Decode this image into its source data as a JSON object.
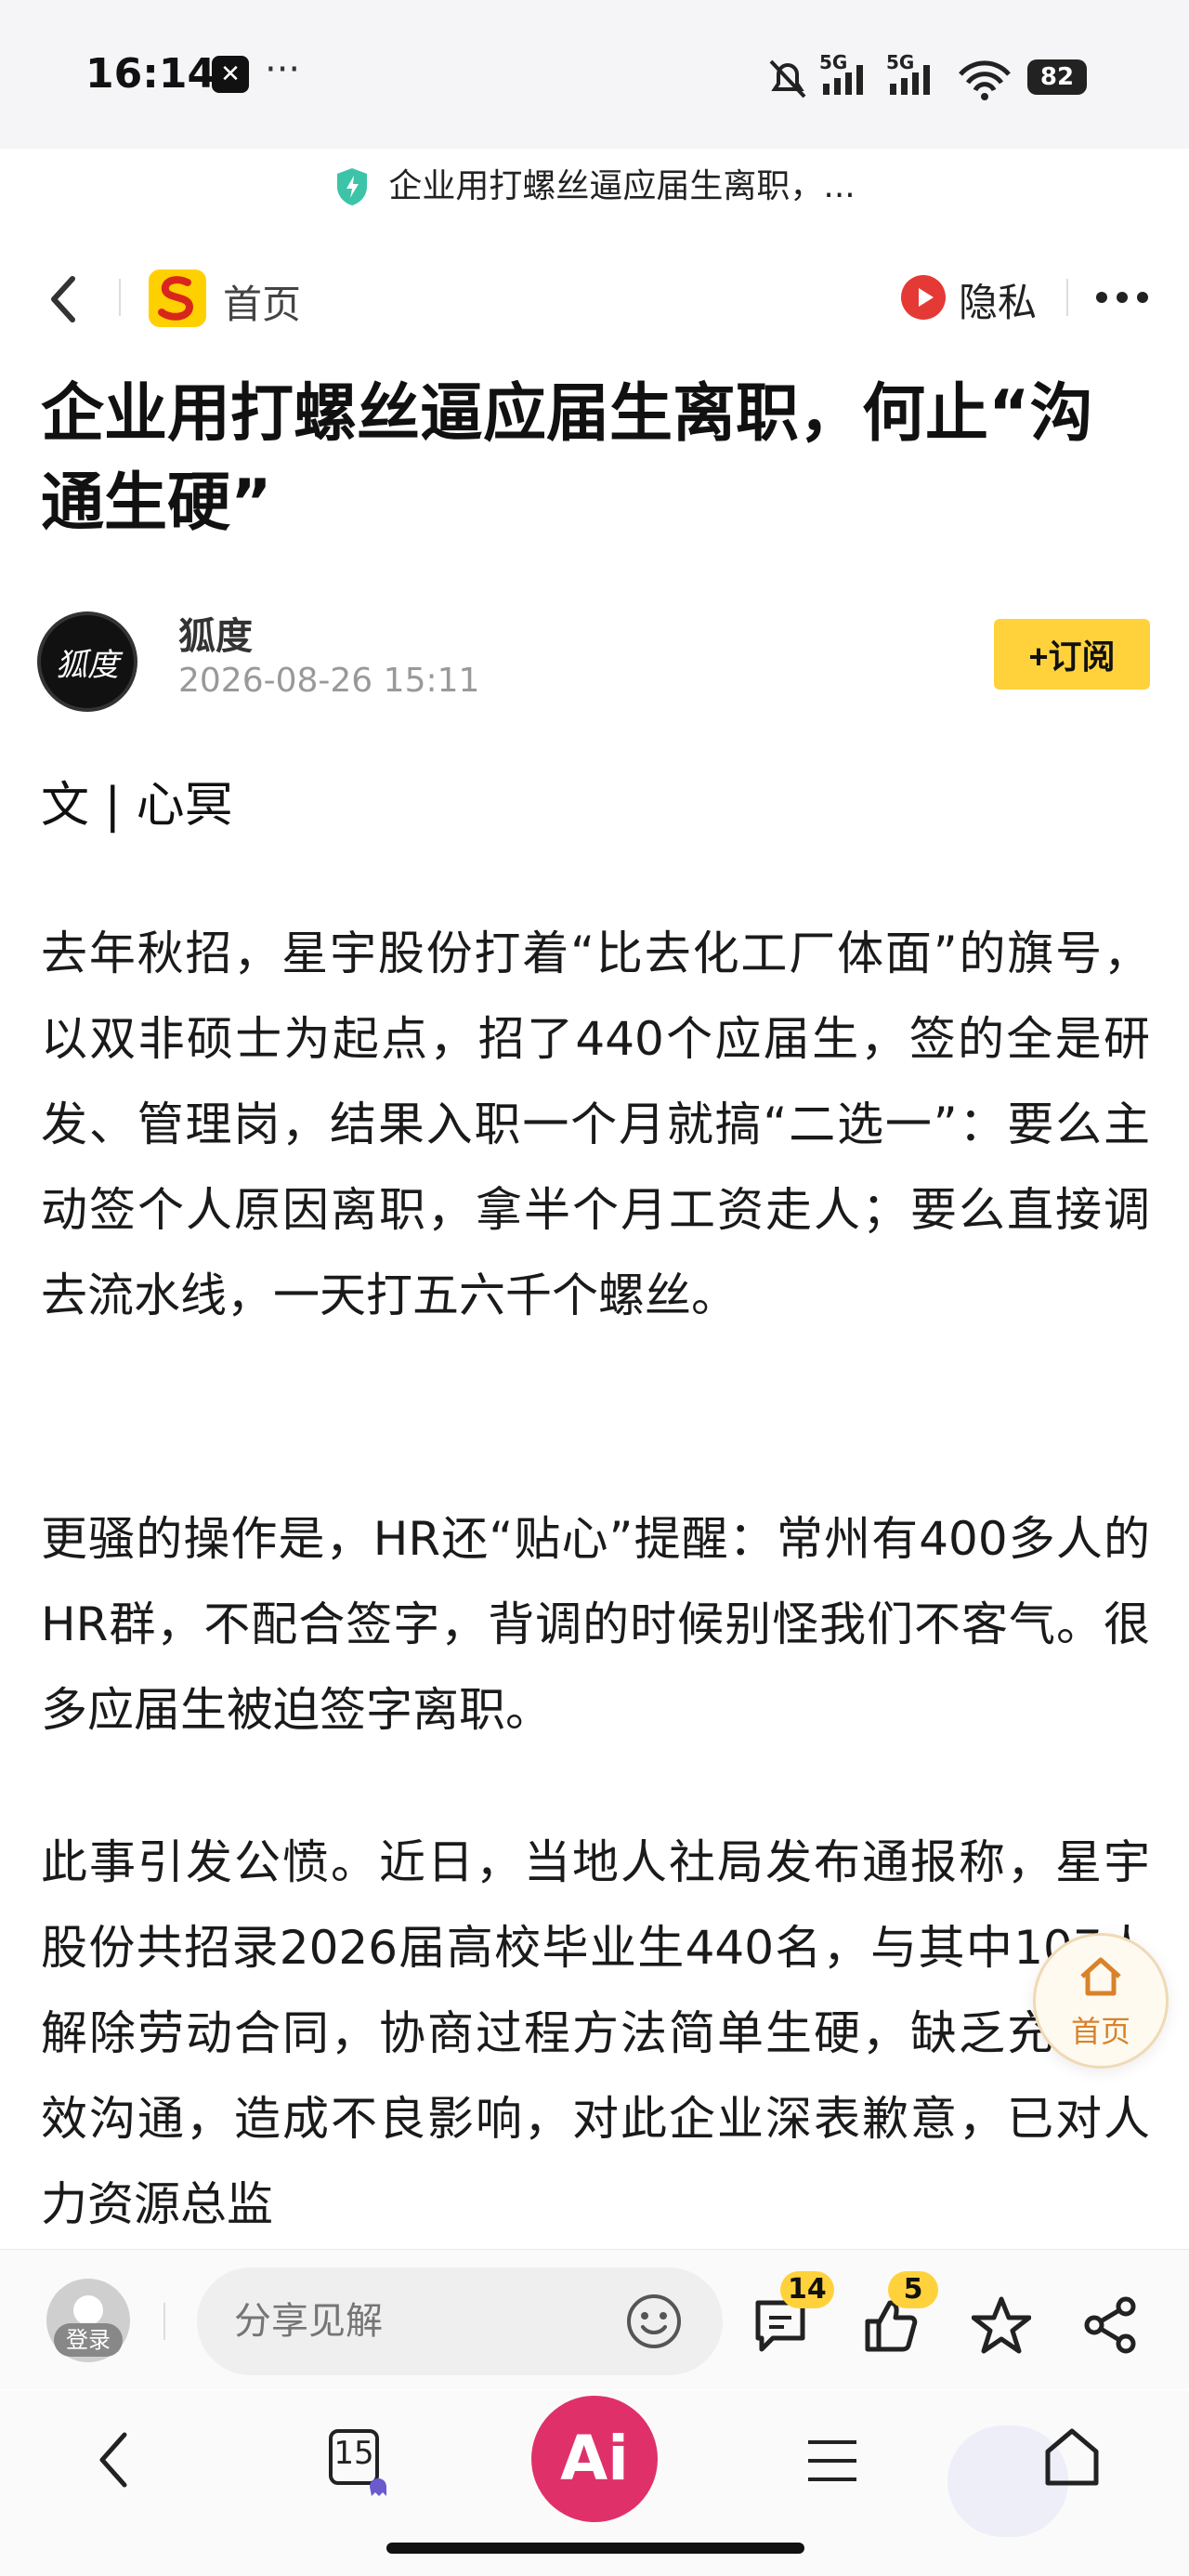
{
  "status_bar": {
    "time": "16:14",
    "dots": "···",
    "signal_label_1": "5G",
    "signal_label_2": "5G",
    "battery": "82"
  },
  "url_bar": {
    "text": "企业用打螺丝逼应届生离职，..."
  },
  "nav": {
    "home_label": "首页",
    "privacy_label": "隐私"
  },
  "article": {
    "title": "企业用打螺丝逼应届生离职，何止“沟通生硬”",
    "author": "狐度",
    "date": "2026-08-26 15:11",
    "subscribe_label": "+订阅",
    "avatar_text": "狐度",
    "byline": "文 | 心冥",
    "paragraphs": [
      "去年秋招，星宇股份打着“比去化工厂体面”的旗号，以双非硕士为起点，招了440个应届生，签的全是研发、管理岗，结果入职一个月就搞“二选一”：要么主动签个人原因离职，拿半个月工资走人；要么直接调去流水线，一天打五六千个螺丝。",
      "更骚的操作是，HR还“贴心”提醒：常州有400多人的HR群，不配合签字，背调的时候别怪我们不客气。很多应届生被迫签字离职。",
      "此事引发公愤。近日，当地人社局发布通报称，星宇股份共招录2026届高校毕业生440名，与其中107人解除劳动合同，协商过程方法简单生硬，缺乏充分有效沟通，造成不良影响，对此企业深表歉意，已对人力资源总监"
    ]
  },
  "floating_home": {
    "label": "首页"
  },
  "comment_bar": {
    "login_label": "登录",
    "input_placeholder": "分享见解",
    "comment_count": "14",
    "like_count": "5"
  },
  "browser_bar": {
    "tabs_count": "15",
    "ai_label": "Ai"
  },
  "colors": {
    "accent_yellow": "#ffd23c",
    "ai_pink": "#e0306a",
    "privacy_red": "#e53935"
  }
}
